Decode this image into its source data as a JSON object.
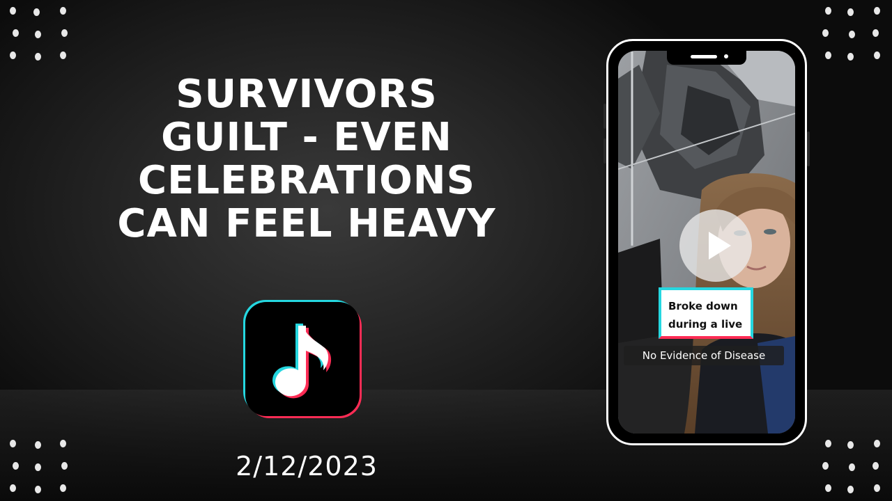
{
  "headline": {
    "line1": "SURVIVORS",
    "line2": "GUILT - EVEN",
    "line3": "CELEBRATIONS",
    "line4": "CAN FEEL HEAVY"
  },
  "date": "2/12/2023",
  "video": {
    "caption_line1": "Broke down",
    "caption_line2": "during a live",
    "subtitle": "No Evidence of Disease"
  },
  "icons": {
    "app_icon": "tiktok-icon",
    "play": "play-icon"
  },
  "colors": {
    "tiktok_cyan": "#25d7e0",
    "tiktok_red": "#fe2c55",
    "background": "#1e1e1e",
    "text": "#ffffff"
  }
}
